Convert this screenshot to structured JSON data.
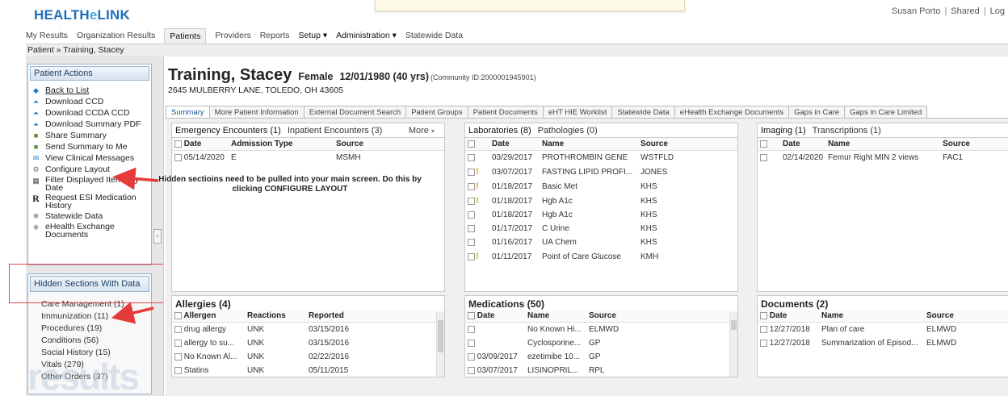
{
  "header": {
    "logo_main": "HEALTH",
    "logo_e": "e",
    "logo_rest": "LINK",
    "user": "Susan Porto",
    "shared": "Shared",
    "logout": "Log"
  },
  "topnav": {
    "my_results": "My Results",
    "org_results": "Organization Results",
    "patients": "Patients",
    "providers": "Providers",
    "reports": "Reports",
    "setup": "Setup ▾",
    "administration": "Administration ▾",
    "statewide": "Statewide Data"
  },
  "breadcrumb": "Patient » Training, Stacey",
  "patient_actions": {
    "title": "Patient Actions",
    "items": [
      {
        "label": "Back to List",
        "icon": "arrow-left-icon"
      },
      {
        "label": "Download CCD",
        "icon": "download-icon"
      },
      {
        "label": "Download CCDA CCD",
        "icon": "download-icon"
      },
      {
        "label": "Download Summary PDF",
        "icon": "download-icon"
      },
      {
        "label": "Share Summary",
        "icon": "share-icon"
      },
      {
        "label": "Send Summary to Me",
        "icon": "send-icon"
      },
      {
        "label": "View Clinical Messages",
        "icon": "message-icon"
      },
      {
        "label": "Configure Layout",
        "icon": "gear-icon"
      },
      {
        "label": "Filter Displayed Items By Date",
        "icon": "calendar-icon"
      },
      {
        "label": "Request ESI Medication History",
        "icon": "rx-icon"
      },
      {
        "label": "Statewide Data",
        "icon": "spinner-icon"
      },
      {
        "label": "eHealth Exchange Documents",
        "icon": "spinner-icon"
      }
    ]
  },
  "hidden_sections": {
    "title": "Hidden Sections With Data",
    "items": [
      "Care Management (1)",
      "Immunization (11)",
      "Procedures (19)",
      "Conditions (56)",
      "Social History (15)",
      "Vitals (279)",
      "Other Orders (37)"
    ]
  },
  "watermark": "results",
  "patient": {
    "name": "Training, Stacey",
    "gender": "Female",
    "dob": "12/01/1980 (40 yrs)",
    "community_id": "(Community ID:2000001945901)",
    "address": "2645 MULBERRY LANE, TOLEDO, OH 43605"
  },
  "tabs": [
    "Summary",
    "More Patient Information",
    "External Document Search",
    "Patient Groups",
    "Patient Documents",
    "eHT HIE Worklist",
    "Statewide Data",
    "eHealth Exchange Documents",
    "Gaps in Care",
    "Gaps in Care Limited"
  ],
  "encounters": {
    "tab1": "Emergency Encounters (1)",
    "tab2": "Inpatient Encounters (3)",
    "more": "More",
    "headers": [
      "Date",
      "Admission Type",
      "Source"
    ],
    "rows": [
      [
        "05/14/2020",
        "E",
        "MSMH"
      ]
    ]
  },
  "labs": {
    "tab1": "Laboratories (8)",
    "tab2": "Pathologies (0)",
    "headers": [
      "Date",
      "Name",
      "Source"
    ],
    "rows": [
      [
        "03/29/2017",
        "PROTHROMBIN GENE",
        "WSTFLD"
      ],
      [
        "03/07/2017",
        "FASTING LIPID PROFI...",
        "JONES"
      ],
      [
        "01/18/2017",
        "Basic Met",
        "KHS"
      ],
      [
        "01/18/2017",
        "Hgb A1c",
        "KHS"
      ],
      [
        "01/18/2017",
        "Hgb A1c",
        "KHS"
      ],
      [
        "01/17/2017",
        "C Urine",
        "KHS"
      ],
      [
        "01/16/2017",
        "UA Chem",
        "KHS"
      ],
      [
        "01/11/2017",
        "Point of Care Glucose",
        "KMH"
      ]
    ]
  },
  "imaging": {
    "tab1": "Imaging (1)",
    "tab2": "Transcriptions (1)",
    "headers": [
      "Date",
      "Name",
      "Source"
    ],
    "rows": [
      [
        "02/14/2020",
        "Femur Right MIN 2 views",
        "FAC1"
      ]
    ]
  },
  "allergies": {
    "title": "Allergies (4)",
    "headers": [
      "Allergen",
      "Reactions",
      "Reported"
    ],
    "rows": [
      [
        "drug allergy",
        "UNK",
        "03/15/2016"
      ],
      [
        "allergy to su...",
        "UNK",
        "03/15/2016"
      ],
      [
        "No Known Al...",
        "UNK",
        "02/22/2016"
      ],
      [
        "Statins",
        "UNK",
        "05/11/2015"
      ]
    ]
  },
  "medications": {
    "title": "Medications (50)",
    "headers": [
      "Date",
      "Name",
      "Source"
    ],
    "rows": [
      [
        "",
        "No Known Hi...",
        "ELMWD"
      ],
      [
        "",
        "Cyclosporine...",
        "GP"
      ],
      [
        "03/09/2017",
        "ezetimibe 10...",
        "GP"
      ],
      [
        "03/07/2017",
        "LISINOPRIL...",
        "RPL"
      ]
    ]
  },
  "documents": {
    "title": "Documents (2)",
    "headers": [
      "Date",
      "Name",
      "Source"
    ],
    "rows": [
      [
        "12/27/2018",
        "Plan of care",
        "ELMWD"
      ],
      [
        "12/27/2018",
        "Summarization of Episod...",
        "ELMWD"
      ]
    ]
  },
  "callout": "Hidden sectioins need to be pulled into your main screen. Do this by clicking CONFIGURE LAYOUT"
}
